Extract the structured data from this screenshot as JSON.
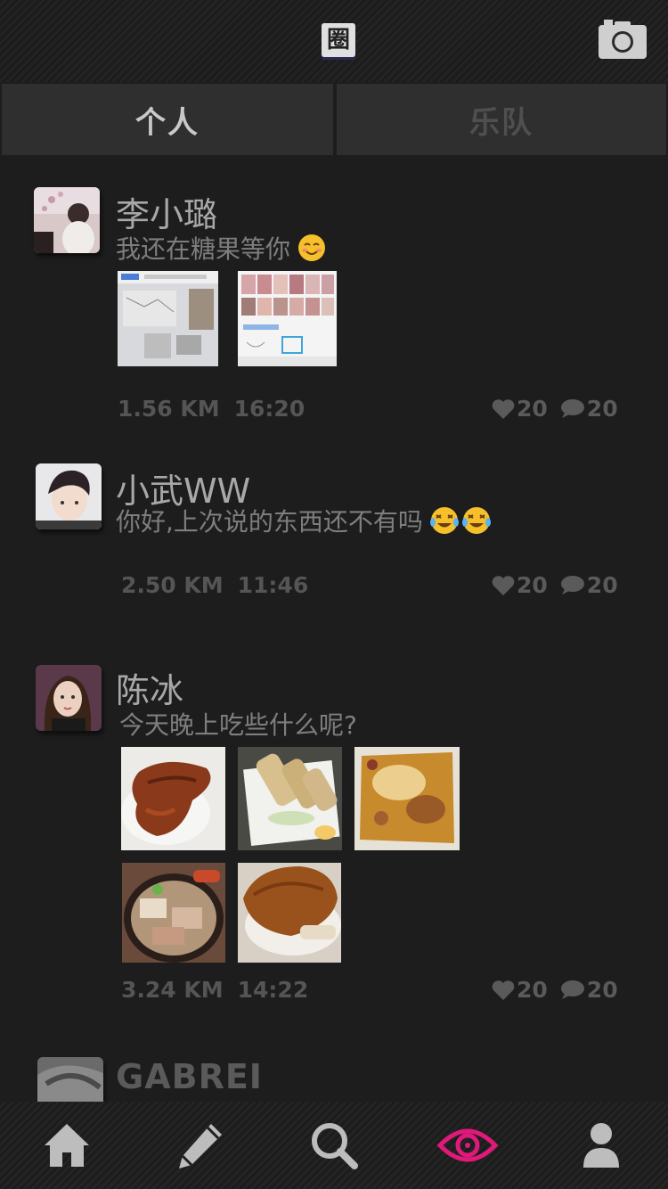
{
  "header": {
    "logo_char": "圈",
    "camera_icon": "camera-icon"
  },
  "tabs": [
    {
      "label": "个人",
      "active": true
    },
    {
      "label": "乐队",
      "active": false
    }
  ],
  "posts": [
    {
      "username": "李小璐",
      "message": "我还在糖果等你",
      "emoji": "smiling-blush",
      "distance": "1.56 KM",
      "time": "16:20",
      "likes": "20",
      "comments": "20"
    },
    {
      "username": "小武WW",
      "message": "你好,上次说的东西还不有吗",
      "emoji": "tears-of-joy x2",
      "distance": "2.50 KM",
      "time": "11:46",
      "likes": "20",
      "comments": "20"
    },
    {
      "username": "陈冰",
      "message": "今天晚上吃些什么呢?",
      "distance": "3.24 KM",
      "time": "14:22",
      "likes": "20",
      "comments": "20"
    },
    {
      "username": "GABREI"
    }
  ],
  "nav": [
    {
      "icon": "home-icon"
    },
    {
      "icon": "pencil-icon"
    },
    {
      "icon": "search-icon"
    },
    {
      "icon": "eye-icon",
      "active": true,
      "color": "#e0197a"
    },
    {
      "icon": "profile-icon"
    }
  ],
  "colors": {
    "background": "#1d1d1d",
    "tab_bg": "#2f2f2f",
    "accent": "#e0197a"
  }
}
